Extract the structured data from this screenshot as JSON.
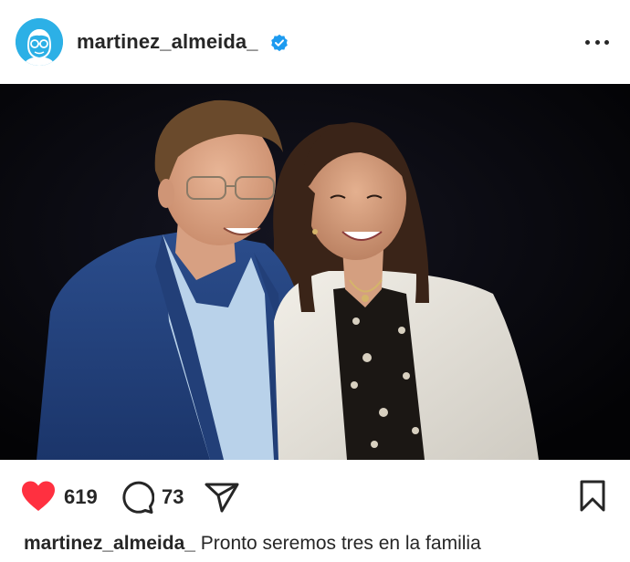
{
  "post": {
    "username": "martinez_almeida_",
    "verified": true,
    "likes": "619",
    "comments": "73",
    "caption_user": "martinez_almeida_",
    "caption_text": "Pronto seremos tres en la familia"
  },
  "icons": {
    "avatar": "avatar-cartoon-icon",
    "verified": "verified-badge-icon",
    "more": "more-options-icon",
    "like": "heart-icon",
    "comment": "comment-icon",
    "share": "send-icon",
    "save": "bookmark-icon"
  },
  "colors": {
    "avatar_bg": "#2cb0e6",
    "verified": "#1d9bf0",
    "like": "#ff3040",
    "text": "#262626",
    "photo_bg": "#050508"
  }
}
